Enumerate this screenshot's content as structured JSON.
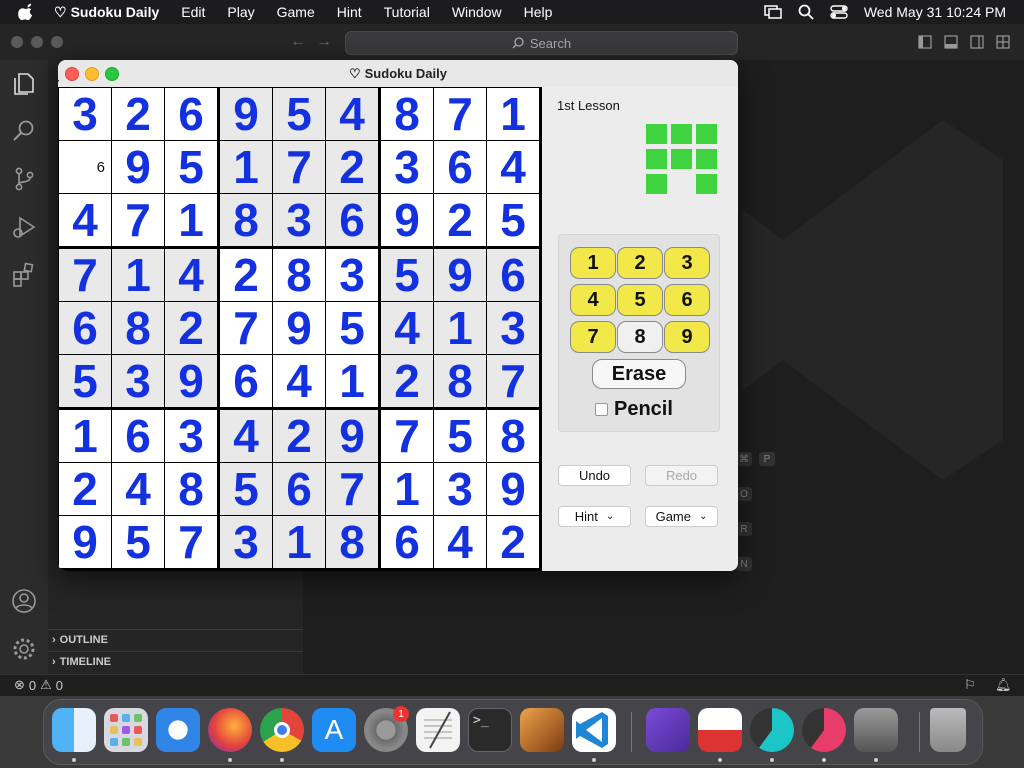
{
  "menubar": {
    "app_name": "Sudoku Daily",
    "items": [
      "Edit",
      "Play",
      "Game",
      "Hint",
      "Tutorial",
      "Window",
      "Help"
    ],
    "clock": "Wed May 31  10:24 PM"
  },
  "vscode": {
    "search_placeholder": "Search",
    "outline_label": "OUTLINE",
    "timeline_label": "TIMELINE",
    "status_errors": "0",
    "status_warnings": "0",
    "shortcut_keys": [
      "⌘",
      "P",
      "O",
      "R",
      "N"
    ]
  },
  "sudoku": {
    "window_title": "Sudoku Daily",
    "lesson_label": "1st Lesson",
    "grid": [
      [
        "3",
        "2",
        "6",
        "9",
        "5",
        "4",
        "8",
        "7",
        "1"
      ],
      [
        "6",
        "9",
        "5",
        "1",
        "7",
        "2",
        "3",
        "6",
        "4"
      ],
      [
        "4",
        "7",
        "1",
        "8",
        "3",
        "6",
        "9",
        "2",
        "5"
      ],
      [
        "7",
        "1",
        "4",
        "2",
        "8",
        "3",
        "5",
        "9",
        "6"
      ],
      [
        "6",
        "8",
        "2",
        "7",
        "9",
        "5",
        "4",
        "1",
        "3"
      ],
      [
        "5",
        "3",
        "9",
        "6",
        "4",
        "1",
        "2",
        "8",
        "7"
      ],
      [
        "1",
        "6",
        "3",
        "4",
        "2",
        "9",
        "7",
        "5",
        "8"
      ],
      [
        "2",
        "4",
        "8",
        "5",
        "6",
        "7",
        "1",
        "3",
        "9"
      ],
      [
        "9",
        "5",
        "7",
        "3",
        "1",
        "8",
        "6",
        "4",
        "2"
      ]
    ],
    "pencil_cell": {
      "row": 1,
      "col": 0
    },
    "number_buttons": [
      "1",
      "2",
      "3",
      "4",
      "5",
      "6",
      "7",
      "8",
      "9"
    ],
    "selected_number": "8",
    "erase_label": "Erase",
    "pencil_label": "Pencil",
    "undo_label": "Undo",
    "redo_label": "Redo",
    "hint_menu_label": "Hint",
    "game_menu_label": "Game",
    "accent_color": "#1431e0",
    "progress_color": "#3fd33f"
  },
  "dock": {
    "apps": [
      "finder-icon",
      "launchpad-icon",
      "safari-icon",
      "firefox-icon",
      "chrome-icon",
      "app-store-icon",
      "system-settings-icon",
      "textedit-icon",
      "terminal-icon",
      "garageband-icon",
      "vscode-icon",
      "visual-studio-icon",
      "disk-utility-icon",
      "speed-app-icon",
      "speed-app-2-icon",
      "rosetta-free-icon",
      "trash-icon"
    ],
    "settings_badge": "1"
  }
}
